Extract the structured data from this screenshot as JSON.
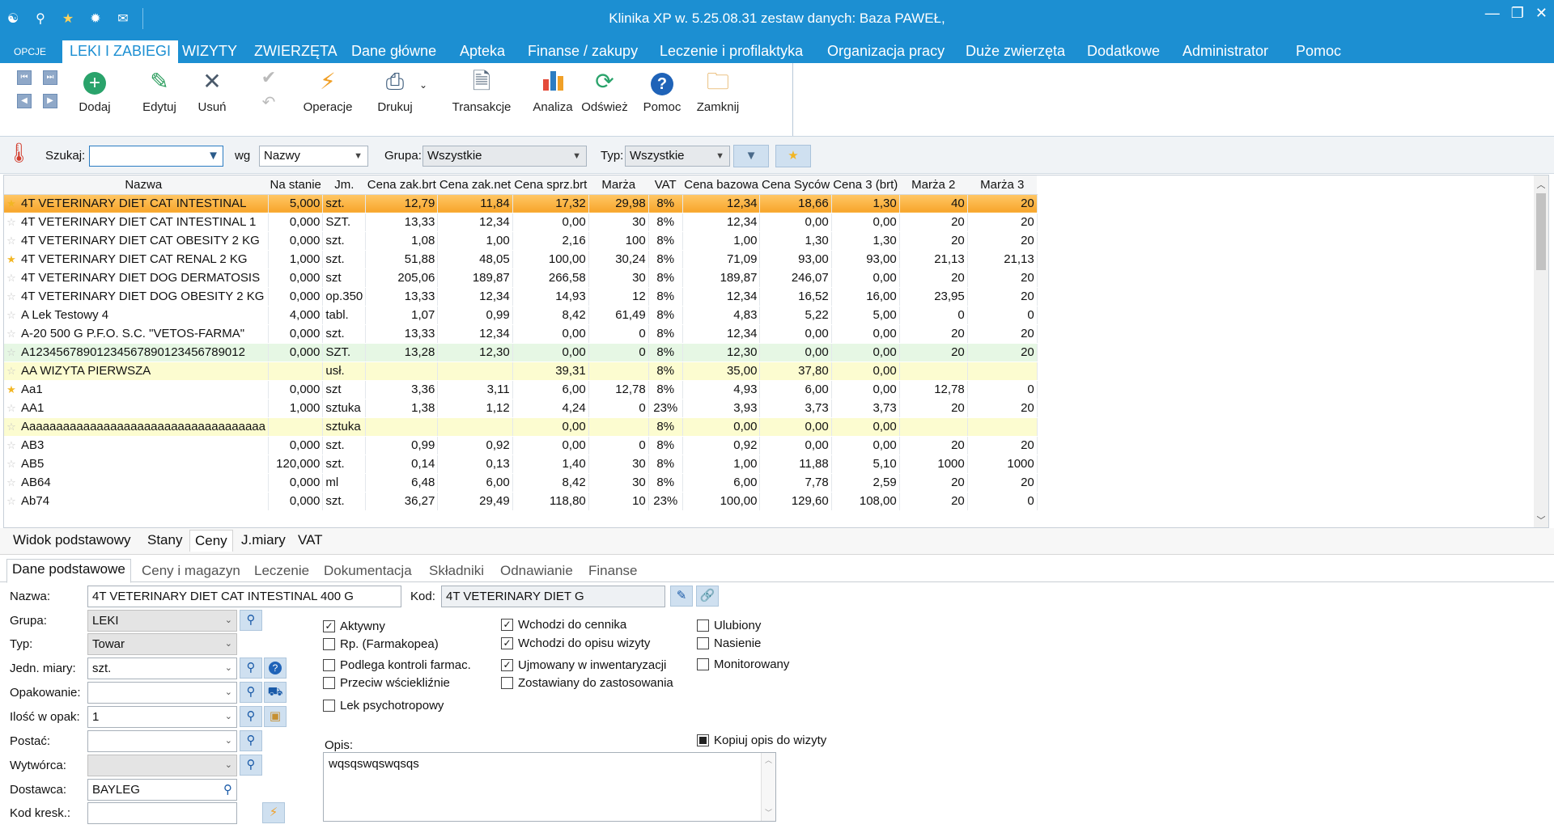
{
  "window": {
    "title": "Klinika XP w. 5.25.08.31 zestaw danych: Baza PAWEŁ,",
    "qa_icons": [
      "app-icon",
      "search-icon",
      "star-icon",
      "gear-icon",
      "mail-icon"
    ]
  },
  "menu": [
    {
      "label": "OPCJE",
      "active": false
    },
    {
      "label": "LEKI I ZABIEGI",
      "active": true
    },
    {
      "label": "WIZYTY",
      "active": false
    },
    {
      "label": "ZWIERZĘTA",
      "active": false
    },
    {
      "label": "Dane główne",
      "active": false
    },
    {
      "label": "Apteka",
      "active": false
    },
    {
      "label": "Finanse / zakupy",
      "active": false
    },
    {
      "label": "Leczenie i profilaktyka",
      "active": false
    },
    {
      "label": "Organizacja pracy",
      "active": false
    },
    {
      "label": "Duże zwierzęta",
      "active": false
    },
    {
      "label": "Dodatkowe",
      "active": false
    },
    {
      "label": "Administrator",
      "active": false
    },
    {
      "label": "Pomoc",
      "active": false
    }
  ],
  "ribbon": {
    "dodaj": "Dodaj",
    "edytuj": "Edytuj",
    "usun": "Usuń",
    "operacje": "Operacje",
    "drukuj": "Drukuj",
    "transakcje": "Transakcje",
    "analiza": "Analiza",
    "odswiez": "Odśwież",
    "pomoc": "Pomoc",
    "zamknij": "Zamknij"
  },
  "search": {
    "szukaj_label": "Szukaj:",
    "szukaj_value": "",
    "wg_label": "wg",
    "wg_value": "Nazwy",
    "grupa_label": "Grupa:",
    "grupa_value": "Wszystkie",
    "typ_label": "Typ:",
    "typ_value": "Wszystkie"
  },
  "grid": {
    "columns": [
      "Nazwa",
      "Na stanie",
      "Jm.",
      "Cena zak.brt",
      "Cena zak.net",
      "Cena sprz.brt",
      "Marża",
      "VAT",
      "Cena bazowa",
      "Cena Syców",
      "Cena 3 (brt)",
      "Marża 2",
      "Marża 3"
    ],
    "rows": [
      {
        "fav": true,
        "style": "sel",
        "cells": [
          "4T VETERINARY DIET CAT INTESTINAL",
          "5,000",
          "szt.",
          "12,79",
          "11,84",
          "17,32",
          "29,98",
          "8%",
          "12,34",
          "18,66",
          "1,30",
          "40",
          "20"
        ]
      },
      {
        "fav": false,
        "style": "",
        "cells": [
          "4T VETERINARY DIET CAT INTESTINAL 1",
          "0,000",
          "SZT.",
          "13,33",
          "12,34",
          "0,00",
          "30",
          "8%",
          "12,34",
          "0,00",
          "0,00",
          "20",
          "20"
        ]
      },
      {
        "fav": false,
        "style": "",
        "cells": [
          "4T VETERINARY DIET CAT OBESITY 2 KG",
          "0,000",
          "szt.",
          "1,08",
          "1,00",
          "2,16",
          "100",
          "8%",
          "1,00",
          "1,30",
          "1,30",
          "20",
          "20"
        ]
      },
      {
        "fav": true,
        "style": "",
        "cells": [
          "4T VETERINARY DIET CAT RENAL 2 KG",
          "1,000",
          "szt.",
          "51,88",
          "48,05",
          "100,00",
          "30,24",
          "8%",
          "71,09",
          "93,00",
          "93,00",
          "21,13",
          "21,13"
        ]
      },
      {
        "fav": false,
        "style": "",
        "cells": [
          "4T VETERINARY DIET DOG DERMATOSIS",
          "0,000",
          "szt",
          "205,06",
          "189,87",
          "266,58",
          "30",
          "8%",
          "189,87",
          "246,07",
          "0,00",
          "20",
          "20"
        ]
      },
      {
        "fav": false,
        "style": "",
        "cells": [
          "4T VETERINARY DIET DOG OBESITY 2 KG",
          "0,000",
          "op.350",
          "13,33",
          "12,34",
          "14,93",
          "12",
          "8%",
          "12,34",
          "16,52",
          "16,00",
          "23,95",
          "20"
        ]
      },
      {
        "fav": false,
        "style": "",
        "cells": [
          "A Lek Testowy 4",
          "4,000",
          "tabl.",
          "1,07",
          "0,99",
          "8,42",
          "61,49",
          "8%",
          "4,83",
          "5,22",
          "5,00",
          "0",
          "0"
        ]
      },
      {
        "fav": false,
        "style": "",
        "cells": [
          "A-20 500 G    P.F.O. S.C. \"VETOS-FARMA\"",
          "0,000",
          "szt.",
          "13,33",
          "12,34",
          "0,00",
          "0",
          "8%",
          "12,34",
          "0,00",
          "0,00",
          "20",
          "20"
        ]
      },
      {
        "fav": false,
        "style": "green",
        "cells": [
          "A12345678901234567890123456789012",
          "0,000",
          "SZT.",
          "13,28",
          "12,30",
          "0,00",
          "0",
          "8%",
          "12,30",
          "0,00",
          "0,00",
          "20",
          "20"
        ]
      },
      {
        "fav": false,
        "style": "yellow",
        "cells": [
          "AA WIZYTA PIERWSZA",
          "",
          "usł.",
          "",
          "",
          "39,31",
          "",
          "8%",
          "35,00",
          "37,80",
          "0,00",
          "",
          ""
        ]
      },
      {
        "fav": true,
        "style": "",
        "cells": [
          "Aa1",
          "0,000",
          "szt",
          "3,36",
          "3,11",
          "6,00",
          "12,78",
          "8%",
          "4,93",
          "6,00",
          "0,00",
          "12,78",
          "0"
        ]
      },
      {
        "fav": false,
        "style": "",
        "cells": [
          "AA1",
          "1,000",
          "sztuka",
          "1,38",
          "1,12",
          "4,24",
          "0",
          "23%",
          "3,93",
          "3,73",
          "3,73",
          "20",
          "20"
        ]
      },
      {
        "fav": false,
        "style": "yellow",
        "cells": [
          "Aaaaaaaaaaaaaaaaaaaaaaaaaaaaaaaaaaaa",
          "",
          "sztuka",
          "",
          "",
          "0,00",
          "",
          "8%",
          "0,00",
          "0,00",
          "0,00",
          "",
          ""
        ]
      },
      {
        "fav": false,
        "style": "",
        "cells": [
          "AB3",
          "0,000",
          "szt.",
          "0,99",
          "0,92",
          "0,00",
          "0",
          "8%",
          "0,92",
          "0,00",
          "0,00",
          "20",
          "20"
        ]
      },
      {
        "fav": false,
        "style": "",
        "cells": [
          "AB5",
          "120,000",
          "szt.",
          "0,14",
          "0,13",
          "1,40",
          "30",
          "8%",
          "1,00",
          "11,88",
          "5,10",
          "1000",
          "1000"
        ]
      },
      {
        "fav": false,
        "style": "",
        "cells": [
          "AB64",
          "0,000",
          "ml",
          "6,48",
          "6,00",
          "8,42",
          "30",
          "8%",
          "6,00",
          "7,78",
          "2,59",
          "20",
          "20"
        ]
      },
      {
        "fav": false,
        "style": "",
        "cells": [
          "Ab74",
          "0,000",
          "szt.",
          "36,27",
          "29,49",
          "118,80",
          "10",
          "23%",
          "100,00",
          "129,60",
          "108,00",
          "20",
          "0"
        ]
      }
    ]
  },
  "view_tabs": [
    "Widok podstawowy",
    "Stany",
    "Ceny",
    "J.miary",
    "VAT"
  ],
  "detail_tabs": [
    "Dane podstawowe",
    "Ceny i magazyn",
    "Leczenie",
    "Dokumentacja",
    "Składniki",
    "Odnawianie",
    "Finanse"
  ],
  "form": {
    "nazwa_label": "Nazwa:",
    "nazwa_value": "4T VETERINARY DIET CAT INTESTINAL  400 G",
    "kod_label": "Kod:",
    "kod_value": "4T VETERINARY DIET G",
    "grupa_label": "Grupa:",
    "grupa_value": "LEKI",
    "typ_label": "Typ:",
    "typ_value": "Towar",
    "jm_label": "Jedn. miary:",
    "jm_value": "szt.",
    "opak_label": "Opakowanie:",
    "opak_value": "",
    "ilosc_label": "Ilość w opak:",
    "ilosc_value": "1",
    "postac_label": "Postać:",
    "postac_value": "",
    "wytworca_label": "Wytwórca:",
    "wytworca_value": "",
    "dostawca_label": "Dostawca:",
    "dostawca_value": "BAYLEG",
    "kod_kresk_label": "Kod kresk.:",
    "kod_kresk_value": "",
    "opis_label": "Opis:",
    "opis_value": "wqsqswqswqsqs",
    "kopiuj_label": "Kopiuj opis do wizyty"
  },
  "checkboxes": [
    {
      "label": "Aktywny",
      "checked": true
    },
    {
      "label": "Rp. (Farmakopea)",
      "checked": false
    },
    {
      "label": "Podlega kontroli farmac.",
      "checked": false
    },
    {
      "label": "Przeciw wściekliźnie",
      "checked": false
    },
    {
      "label": "Lek psychotropowy",
      "checked": false
    },
    {
      "label": "Wchodzi do cennika",
      "checked": true
    },
    {
      "label": "Wchodzi do opisu wizyty",
      "checked": true
    },
    {
      "label": "Ujmowany w inwentaryzacji",
      "checked": true
    },
    {
      "label": "Zostawiany do zastosowania",
      "checked": false
    },
    {
      "label": "Ulubiony",
      "checked": false
    },
    {
      "label": "Nasienie",
      "checked": false
    },
    {
      "label": "Monitorowany",
      "checked": false
    }
  ]
}
